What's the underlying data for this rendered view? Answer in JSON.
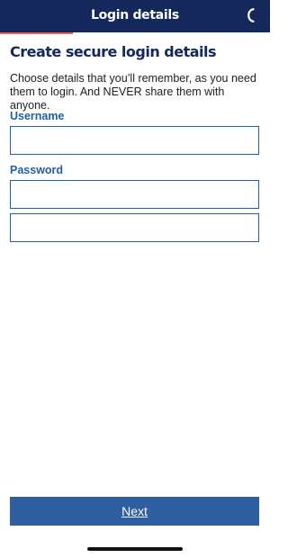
{
  "header": {
    "title": "Login details",
    "call_icon": "phone-icon",
    "background_color": "#14285c",
    "progress_fraction": 0.27,
    "progress_color": "#e2694a"
  },
  "main": {
    "title": "Create secure login details",
    "intro": "Choose details that you’ll remember, as you need them to login. And NEVER share them with anyone.",
    "username": {
      "label": "Username",
      "value": ""
    },
    "password": {
      "label": "Password",
      "value": "",
      "confirm_value": ""
    },
    "accent_color": "#1f5fa8"
  },
  "footer": {
    "next_label": "Next",
    "button_color": "#2f5fa1"
  }
}
